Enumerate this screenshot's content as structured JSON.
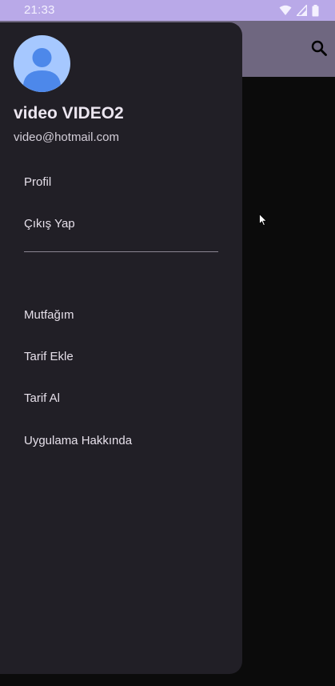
{
  "status_bar": {
    "time": "21:33",
    "icons": [
      "wifi-icon",
      "signal-icon",
      "battery-icon"
    ]
  },
  "app_bar": {
    "search_icon": "search-icon",
    "color": "#6f6780"
  },
  "drawer": {
    "user": {
      "avatar_icon": "account-circle-icon",
      "name": "video VIDEO2",
      "email": "video@hotmail.com"
    },
    "account_items": [
      {
        "label": "Profil"
      },
      {
        "label": "Çıkış Yap"
      }
    ],
    "main_items": [
      {
        "label": "Mutfağım"
      },
      {
        "label": "Tarif Ekle"
      },
      {
        "label": "Tarif Al"
      },
      {
        "label": "Uygulama Hakkında"
      }
    ]
  },
  "colors": {
    "status_bar": "#b9a9e8",
    "drawer_bg": "#211f26",
    "avatar_bg": "#a6c8ff",
    "avatar_fg": "#4d88ea",
    "text_primary": "#ece6f0"
  }
}
